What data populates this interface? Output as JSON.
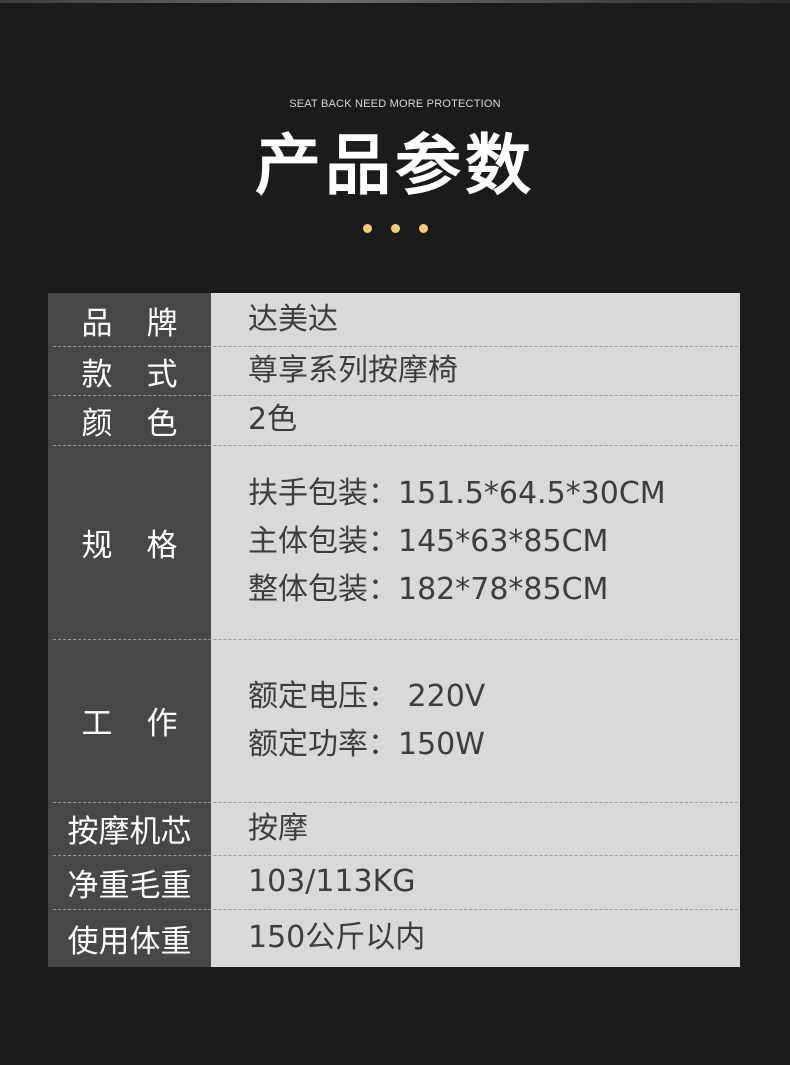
{
  "header": {
    "subtitle": "SEAT BACK NEED MORE PROTECTION",
    "title": "产品参数"
  },
  "colors": {
    "accent_dots": "#f1cf6f",
    "label_bg": "#474747",
    "value_bg": "#d9d9d9"
  },
  "specs": [
    {
      "label_a": "品",
      "label_b": "牌",
      "values": [
        "达美达"
      ]
    },
    {
      "label_a": "款",
      "label_b": "式",
      "values": [
        "尊享系列按摩椅"
      ]
    },
    {
      "label_a": "颜",
      "label_b": "色",
      "values": [
        "2色"
      ]
    },
    {
      "label_a": "规",
      "label_b": "格",
      "values": [
        "扶手包装：151.5*64.5*30CM",
        "主体包装：145*63*85CM",
        "整体包装：182*78*85CM"
      ]
    },
    {
      "label_a": "工",
      "label_b": "作",
      "values": [
        "额定电压： 220V",
        "额定功率：150W"
      ]
    },
    {
      "label": "按摩机芯",
      "values": [
        "按摩"
      ]
    },
    {
      "label": "净重毛重",
      "values": [
        "103/113KG"
      ]
    },
    {
      "label": "使用体重",
      "values": [
        "150公斤以内"
      ]
    }
  ]
}
